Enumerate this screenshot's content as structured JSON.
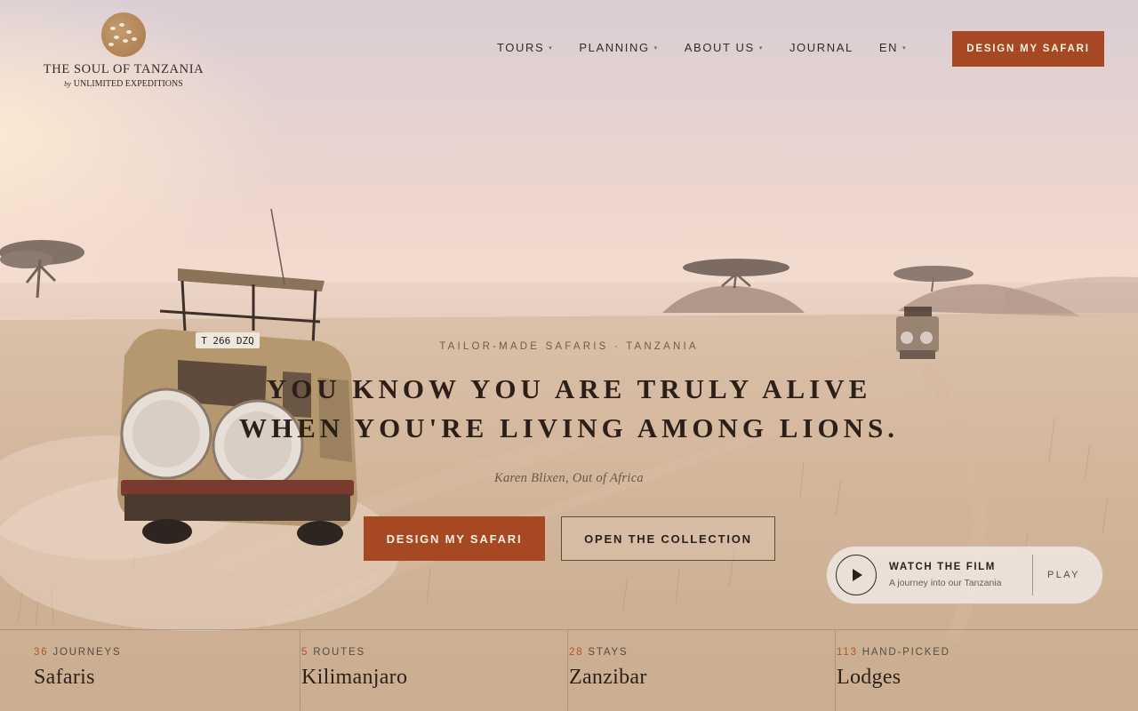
{
  "brand": {
    "name": "THE SOUL OF TANZANIA",
    "by_prefix": "by",
    "by_company": "UNLIMITED EXPEDITIONS"
  },
  "nav": {
    "items": [
      {
        "label": "TOURS",
        "has_dropdown": true
      },
      {
        "label": "PLANNING",
        "has_dropdown": true
      },
      {
        "label": "ABOUT US",
        "has_dropdown": true
      },
      {
        "label": "JOURNAL",
        "has_dropdown": false
      },
      {
        "label": "EN",
        "has_dropdown": true
      }
    ],
    "caret": "▾",
    "cta": "DESIGN MY SAFARI"
  },
  "hero": {
    "eyebrow": "TAILOR-MADE SAFARIS · TANZANIA",
    "headline_line1": "YOU KNOW YOU ARE TRULY ALIVE",
    "headline_line2": "WHEN YOU'RE LIVING AMONG LIONS.",
    "quote": "Karen Blixen, Out of Africa",
    "primary_cta": "DESIGN MY SAFARI",
    "secondary_cta": "OPEN THE COLLECTION"
  },
  "film": {
    "title": "WATCH THE FILM",
    "subtitle": "A journey into our Tanzania",
    "action": "PLAY"
  },
  "vehicle": {
    "plate": "T 266 DZQ"
  },
  "stats": [
    {
      "number": "36",
      "unit": "JOURNEYS",
      "label": "Safaris"
    },
    {
      "number": "5",
      "unit": "ROUTES",
      "label": "Kilimanjaro"
    },
    {
      "number": "28",
      "unit": "STAYS",
      "label": "Zanzibar"
    },
    {
      "number": "113",
      "unit": "HAND-PICKED",
      "label": "Lodges"
    }
  ],
  "colors": {
    "accent": "#a64821",
    "accent_number": "#b5532a",
    "text_dark": "#2b2119"
  }
}
